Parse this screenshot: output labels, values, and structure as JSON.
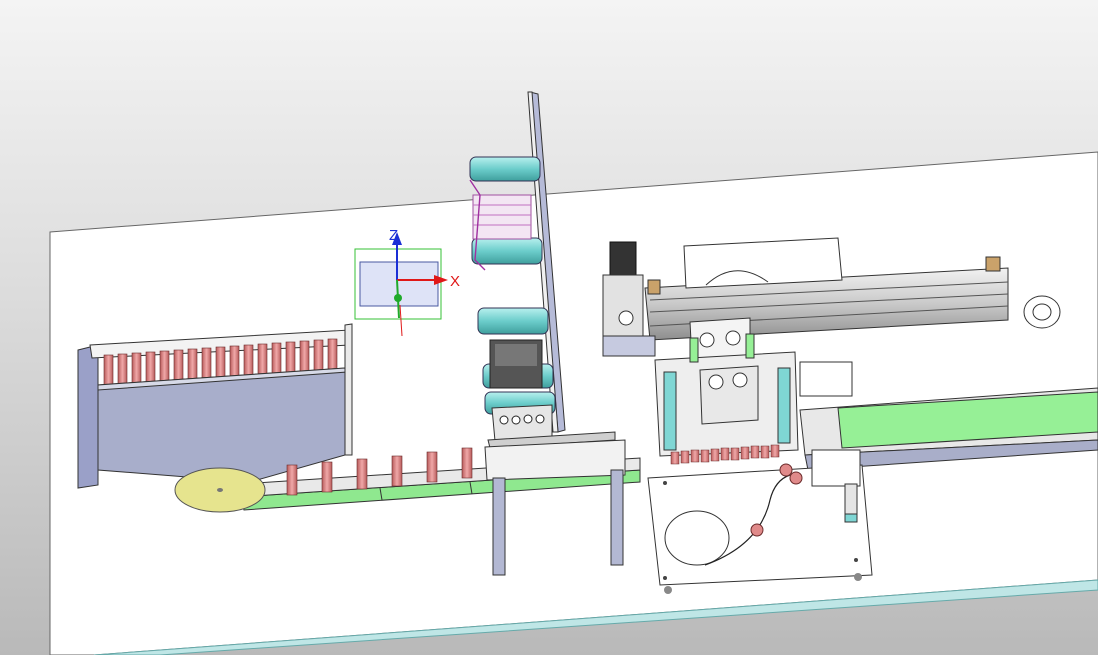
{
  "viewport": {
    "background_top": "#f4f4f4",
    "background_bottom": "#b9b9b9"
  },
  "triad": {
    "x_label": "X",
    "z_label": "Z",
    "x_color": "#e01818",
    "z_color": "#1a2fd6",
    "y_color": "#1faa2a"
  },
  "palette": {
    "base_plate": "#ffffff",
    "frame_blue_grey": "#a7adc9",
    "cylinder_red": "#d88080",
    "roller_teal": "#7fd6d4",
    "conveyor_green": "#96f096",
    "turntable_yellow": "#e4e48a"
  }
}
